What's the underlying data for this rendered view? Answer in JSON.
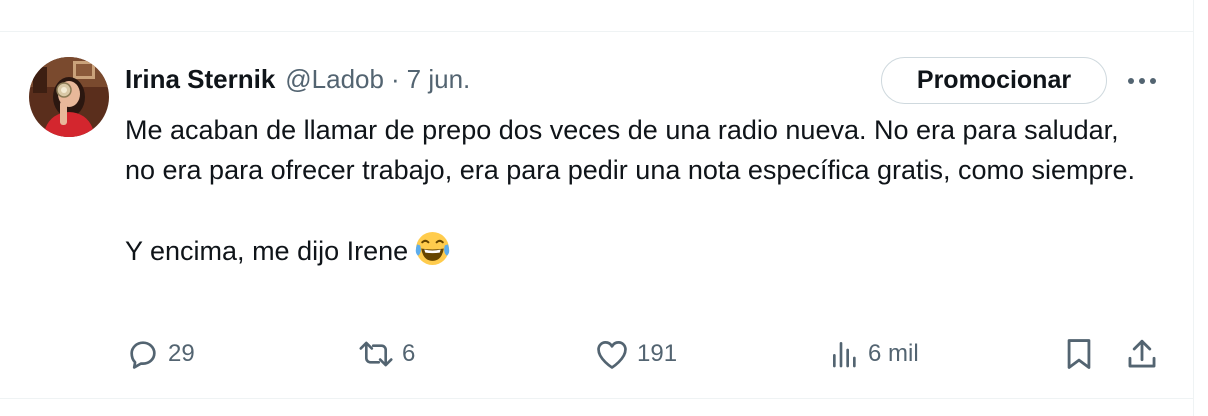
{
  "tweet": {
    "author_name": "Irina Sternik",
    "handle": "@Ladob",
    "separator": "·",
    "date": "7 jun.",
    "promote_label": "Promocionar",
    "text_paragraph_1": "Me acaban de llamar de prepo dos veces de una radio nueva. No era para saludar, no era para ofrecer trabajo, era para pedir una nota específica gratis, como siempre.",
    "text_paragraph_2": "Y encima, me dijo Irene",
    "emoji": "face-with-tears-of-joy"
  },
  "actions": {
    "replies": "29",
    "reposts": "6",
    "likes": "191",
    "views": "6 mil"
  },
  "icons": {
    "more": "more-horizontal-icon",
    "reply": "reply-icon",
    "repost": "repost-icon",
    "like": "heart-icon",
    "views": "analytics-icon",
    "bookmark": "bookmark-icon",
    "share": "share-icon"
  },
  "colors": {
    "text_primary": "#0f1419",
    "text_secondary": "#536471",
    "border": "#cfd9de",
    "divider": "#eff3f4"
  }
}
